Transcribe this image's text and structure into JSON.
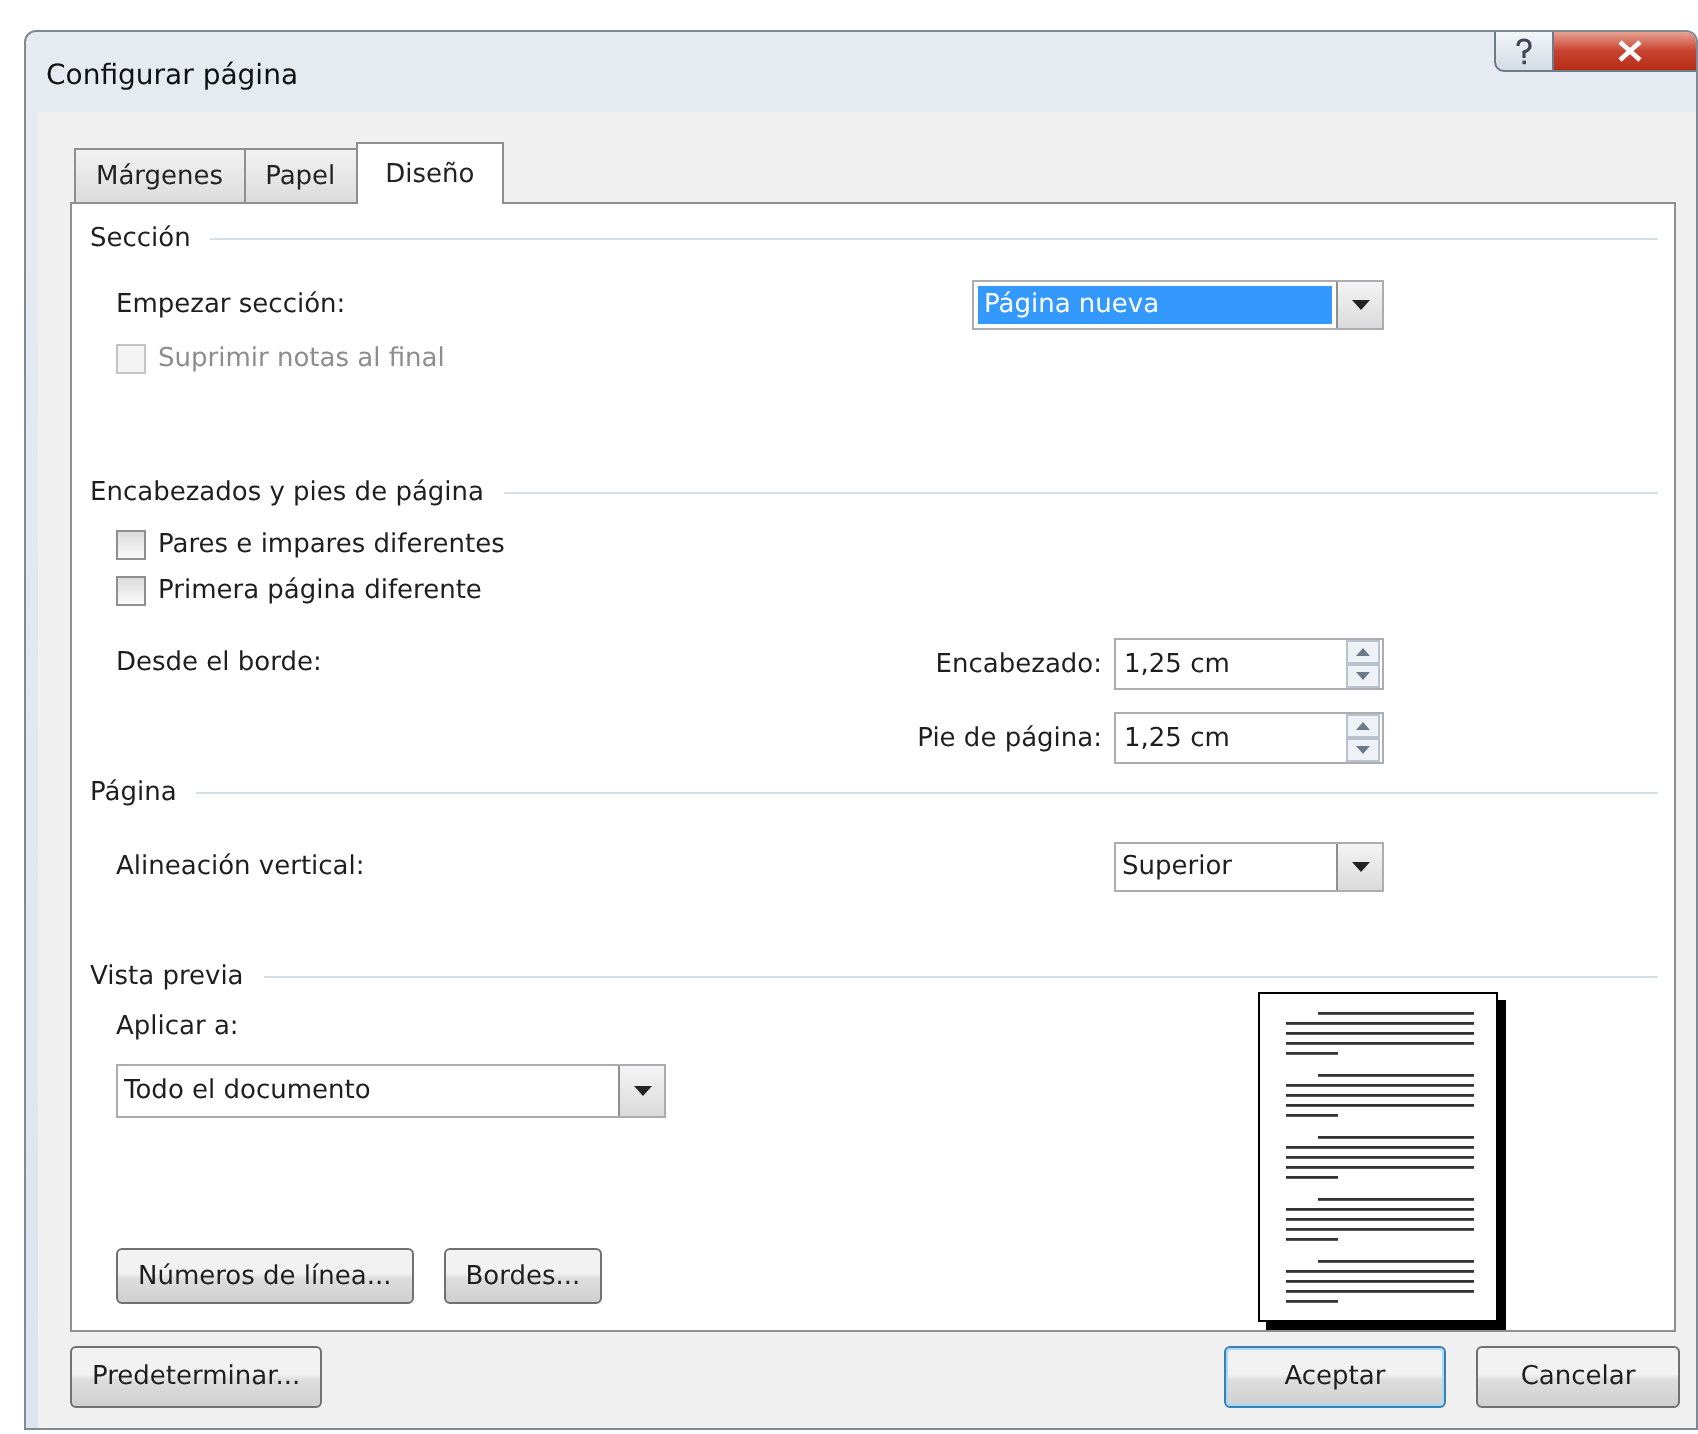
{
  "window": {
    "title": "Configurar página"
  },
  "tabs": [
    {
      "label": "Márgenes",
      "selected": false
    },
    {
      "label": "Papel",
      "selected": false
    },
    {
      "label": "Diseño",
      "selected": true
    }
  ],
  "sections": [
    {
      "title": "Sección",
      "rows": [
        {
          "kind": "dropdown",
          "label": "Empezar sección:",
          "value": "Página nueva",
          "highlighted": true
        },
        {
          "kind": "checkbox",
          "label": "Suprimir notas al final",
          "checked": false,
          "disabled": true
        }
      ]
    },
    {
      "title": "Encabezados y pies de página",
      "rows": [
        {
          "kind": "checkbox",
          "label": "Pares e impares diferentes",
          "checked": false,
          "disabled": false
        },
        {
          "kind": "checkbox",
          "label": "Primera página diferente",
          "checked": false,
          "disabled": false
        },
        {
          "kind": "spinners",
          "label": "Desde el borde:",
          "fields": [
            {
              "label": "Encabezado:",
              "value": "1,25 cm"
            },
            {
              "label": "Pie de página:",
              "value": "1,25 cm"
            }
          ]
        }
      ]
    },
    {
      "title": "Página",
      "rows": [
        {
          "kind": "dropdown",
          "label": "Alineación vertical:",
          "value": "Superior",
          "highlighted": false
        }
      ]
    }
  ],
  "preview": {
    "title": "Vista previa",
    "apply_label": "Aplicar a:",
    "apply_value": "Todo el documento",
    "buttons": [
      "Números de línea...",
      "Bordes..."
    ]
  },
  "footer": {
    "left_button": "Predeterminar...",
    "buttons": [
      {
        "label": "Aceptar",
        "default": true
      },
      {
        "label": "Cancelar",
        "default": false
      }
    ]
  }
}
